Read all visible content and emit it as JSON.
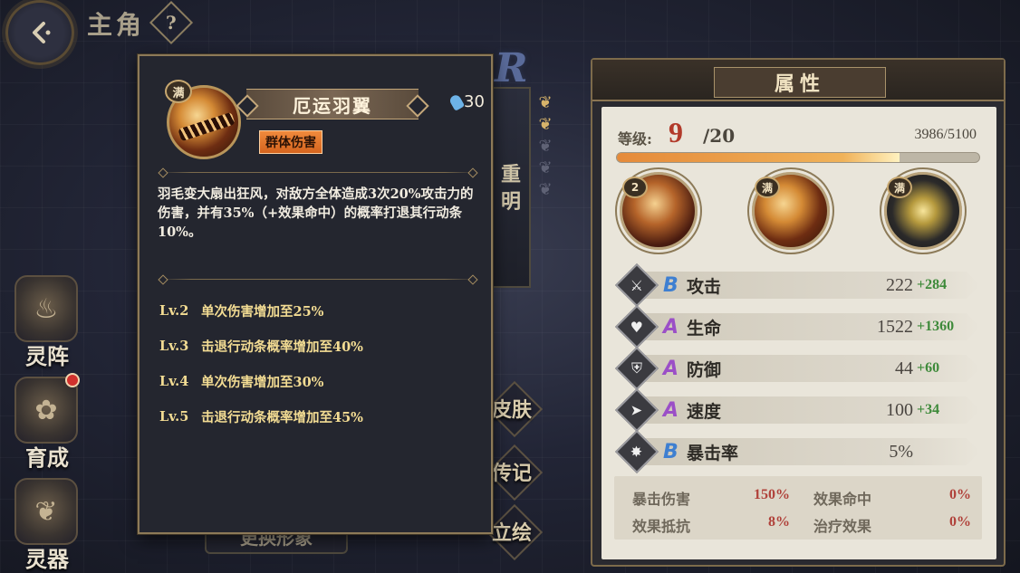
{
  "header": {
    "title": "主角",
    "help_label": "?"
  },
  "side_nav": [
    {
      "label": "灵阵",
      "icon": "flame-formation-icon",
      "badge": false
    },
    {
      "label": "育成",
      "icon": "flower-growth-icon",
      "badge": true
    },
    {
      "label": "灵器",
      "icon": "lotus-artifact-icon",
      "badge": false
    }
  ],
  "middle": {
    "rank_letter": "R",
    "name_vertical": "重明",
    "buttons": [
      "皮肤",
      "传记",
      "立绘"
    ],
    "change_look": "更换形象"
  },
  "skill_popup": {
    "max_badge": "满",
    "name": "厄运羽翼",
    "cost": "30",
    "tag": "群体伤害",
    "description": "羽毛变大扇出狂风，对敌方全体造成3次20%攻击力的伤害，并有35%（+效果命中）的概率打退其行动条10%。",
    "levels": [
      {
        "lv": "Lv.2",
        "text": "单次伤害增加至25%"
      },
      {
        "lv": "Lv.3",
        "text": "击退行动条概率增加至40%"
      },
      {
        "lv": "Lv.4",
        "text": "单次伤害增加至30%"
      },
      {
        "lv": "Lv.5",
        "text": "击退行动条概率增加至45%"
      }
    ]
  },
  "attributes": {
    "title": "属性",
    "level_label": "等级:",
    "level": "9",
    "level_max": "/20",
    "exp": "3986/5100",
    "exp_fraction": 0.78,
    "skills": [
      {
        "badge": "2",
        "icon": "skill-1-icon"
      },
      {
        "badge": "满",
        "icon": "skill-2-icon"
      },
      {
        "badge": "满",
        "icon": "skill-3-icon"
      }
    ],
    "stats": [
      {
        "icon": "attack-icon",
        "glyph": "⚔",
        "grade": "B",
        "name": "攻击",
        "base": "222",
        "bonus": "+284"
      },
      {
        "icon": "health-icon",
        "glyph": "♥",
        "grade": "A",
        "name": "生命",
        "base": "1522",
        "bonus": "+1360"
      },
      {
        "icon": "defense-icon",
        "glyph": "⛨",
        "grade": "A",
        "name": "防御",
        "base": "44",
        "bonus": "+60"
      },
      {
        "icon": "speed-icon",
        "glyph": "➤",
        "grade": "A",
        "name": "速度",
        "base": "100",
        "bonus": "+34"
      },
      {
        "icon": "crit-rate-icon",
        "glyph": "✸",
        "grade": "B",
        "name": "暴击率",
        "base": "5%",
        "bonus": ""
      }
    ],
    "sub_stats": [
      {
        "name": "暴击伤害",
        "value": "150%"
      },
      {
        "name": "效果命中",
        "value": "0%"
      },
      {
        "name": "效果抵抗",
        "value": "8%"
      },
      {
        "name": "治疗效果",
        "value": "0%"
      }
    ]
  }
}
